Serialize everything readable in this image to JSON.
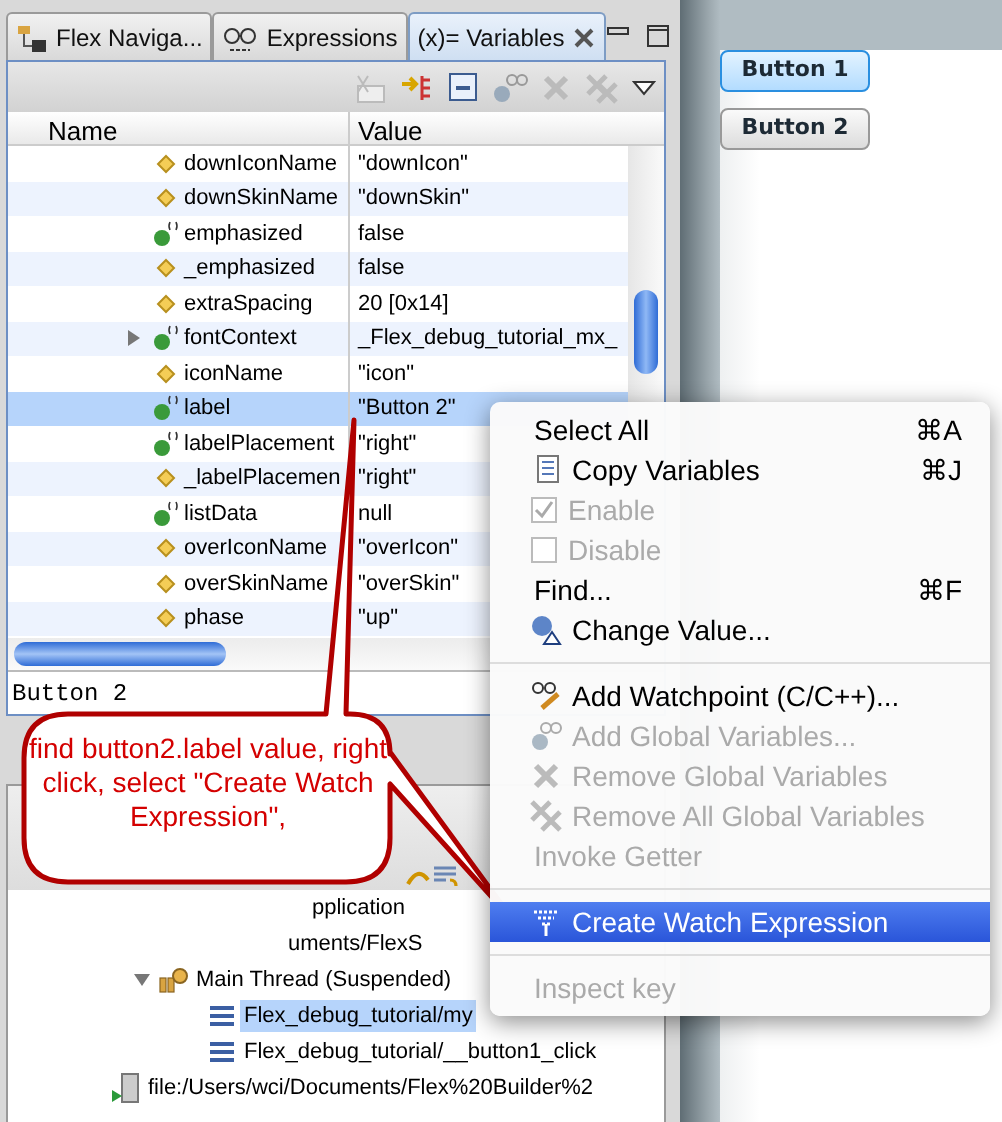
{
  "tabs": [
    {
      "label": "Flex Naviga...",
      "selected": false,
      "kind": "navigator"
    },
    {
      "label": "Expressions",
      "selected": false,
      "kind": "expressions"
    },
    {
      "label": "(x)= Variables",
      "selected": true,
      "kind": "variables"
    }
  ],
  "variables": {
    "columns": [
      "Name",
      "Value"
    ],
    "rows": [
      {
        "name": "downIconName",
        "value": "\"downIcon\"",
        "kind": "field",
        "selected": false
      },
      {
        "name": "downSkinName",
        "value": "\"downSkin\"",
        "kind": "field",
        "selected": false
      },
      {
        "name": "emphasized",
        "value": "false",
        "kind": "getter",
        "selected": false
      },
      {
        "name": "_emphasized",
        "value": "false",
        "kind": "field",
        "selected": false
      },
      {
        "name": "extraSpacing",
        "value": "20 [0x14]",
        "kind": "field",
        "selected": false
      },
      {
        "name": "fontContext",
        "value": "_Flex_debug_tutorial_mx_",
        "kind": "getter",
        "selected": false,
        "expanded": false
      },
      {
        "name": "iconName",
        "value": "\"icon\"",
        "kind": "field",
        "selected": false
      },
      {
        "name": "label",
        "value": "\"Button 2\"",
        "kind": "getter",
        "selected": true
      },
      {
        "name": "labelPlacement",
        "value": "\"right\"",
        "kind": "getter",
        "selected": false
      },
      {
        "name": "_labelPlacemen",
        "value": "\"right\"",
        "kind": "field",
        "selected": false
      },
      {
        "name": "listData",
        "value": "null",
        "kind": "getter",
        "selected": false
      },
      {
        "name": "overIconName",
        "value": "\"overIcon\"",
        "kind": "field",
        "selected": false
      },
      {
        "name": "overSkinName",
        "value": "\"overSkin\"",
        "kind": "field",
        "selected": false
      },
      {
        "name": "phase",
        "value": "\"up\"",
        "kind": "field",
        "selected": false
      }
    ],
    "detail": "Button 2"
  },
  "debug_tree": [
    {
      "label": "pplication",
      "kind": "partial",
      "children": [
        {
          "label": "uments/FlexS",
          "kind": "partial",
          "children": [
            {
              "label": "Main Thread (Suspended)",
              "kind": "thread",
              "expanded": true,
              "children": [
                {
                  "label": "Flex_debug_tutorial/my",
                  "kind": "frame",
                  "selected": true
                },
                {
                  "label": "Flex_debug_tutorial/__button1_click",
                  "kind": "frame",
                  "selected": false
                }
              ]
            }
          ]
        },
        {
          "label": "file:/Users/wci/Documents/Flex%20Builder%2",
          "kind": "file"
        }
      ]
    }
  ],
  "app_buttons": [
    {
      "label": "Button 1",
      "focused": true
    },
    {
      "label": "Button 2",
      "focused": false
    }
  ],
  "context_menu": [
    {
      "label": "Select All",
      "shortcut": "⌘A",
      "kind": "text",
      "disabled": false,
      "selected": false
    },
    {
      "label": "Copy Variables",
      "shortcut": "⌘J",
      "kind": "copy",
      "disabled": false,
      "selected": false
    },
    {
      "label": "Enable",
      "kind": "check",
      "checked": true,
      "disabled": true,
      "selected": false
    },
    {
      "label": "Disable",
      "kind": "check",
      "checked": false,
      "disabled": true,
      "selected": false
    },
    {
      "label": "Find...",
      "shortcut": "⌘F",
      "kind": "text",
      "disabled": false,
      "selected": false
    },
    {
      "label": "Change Value...",
      "kind": "edit",
      "disabled": false,
      "selected": false
    },
    {
      "kind": "separator"
    },
    {
      "label": "Add Watchpoint (C/C++)...",
      "kind": "watchpoint",
      "disabled": false,
      "selected": false
    },
    {
      "label": "Add Global Variables...",
      "kind": "globals",
      "disabled": true,
      "selected": false
    },
    {
      "label": "Remove Global Variables",
      "kind": "remove",
      "disabled": true,
      "selected": false
    },
    {
      "label": "Remove All Global Variables",
      "kind": "removeall",
      "disabled": true,
      "selected": false
    },
    {
      "label": "Invoke Getter",
      "kind": "text",
      "disabled": true,
      "selected": false
    },
    {
      "kind": "separator"
    },
    {
      "label": "Create Watch Expression",
      "kind": "watch",
      "disabled": false,
      "selected": true
    },
    {
      "kind": "separator"
    },
    {
      "label": "Inspect key",
      "kind": "text",
      "disabled": true,
      "selected": false
    }
  ],
  "callout": {
    "text": "find button2.label value, right click, select \"Create Watch Expression\","
  }
}
